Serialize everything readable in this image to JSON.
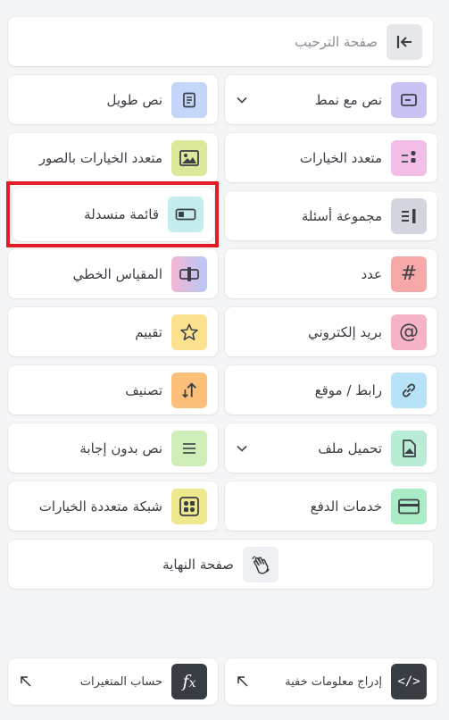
{
  "welcome": {
    "label": "صفحة الترحيب"
  },
  "elements": {
    "long_text": "نص طويل",
    "patterned_text": "نص مع نمط",
    "image_choice": "متعدد الخيارات بالصور",
    "multiple_choice": "متعدد الخيارات",
    "dropdown": "قائمة منسدلة",
    "question_group": "مجموعة أسئلة",
    "linear_scale": "المقياس الخطي",
    "number": "عدد",
    "rating": "تقييم",
    "email": "بريد إلكتروني",
    "ranking": "تصنيف",
    "link": "رابط / موقع",
    "statement": "نص بدون إجابة",
    "file_upload": "تحميل ملف",
    "matrix": "شبكة متعددة الخيارات",
    "payment": "خدمات الدفع"
  },
  "end_screen": {
    "label": "صفحة النهاية"
  },
  "bottom": {
    "calculator": "حساب المتغيرات",
    "hidden_fields": "إدراج معلومات خفية"
  },
  "colors": {
    "highlight": "#e31b23",
    "long_text_icon_bg": "#c5d6fb",
    "patterned_text_icon_bg": "#c9c3f4",
    "image_choice_icon_bg": "#dde99a",
    "multiple_choice_icon_bg": "#f2bde6",
    "dropdown_icon_bg": "#c5ecec",
    "question_group_icon_bg": "#d4d6df",
    "number_icon_bg": "#f7a8a8",
    "rating_icon_bg": "#fbe08e",
    "email_icon_bg": "#f6b3c6",
    "ranking_icon_bg": "#fbbf7a",
    "link_icon_bg": "#b8e2f8",
    "statement_icon_bg": "#cfeeb8",
    "file_upload_icon_bg": "#b9ecd4",
    "matrix_icon_bg": "#eee88e",
    "payment_icon_bg": "#a9ecc6",
    "dark_icon_bg": "#383c43"
  }
}
